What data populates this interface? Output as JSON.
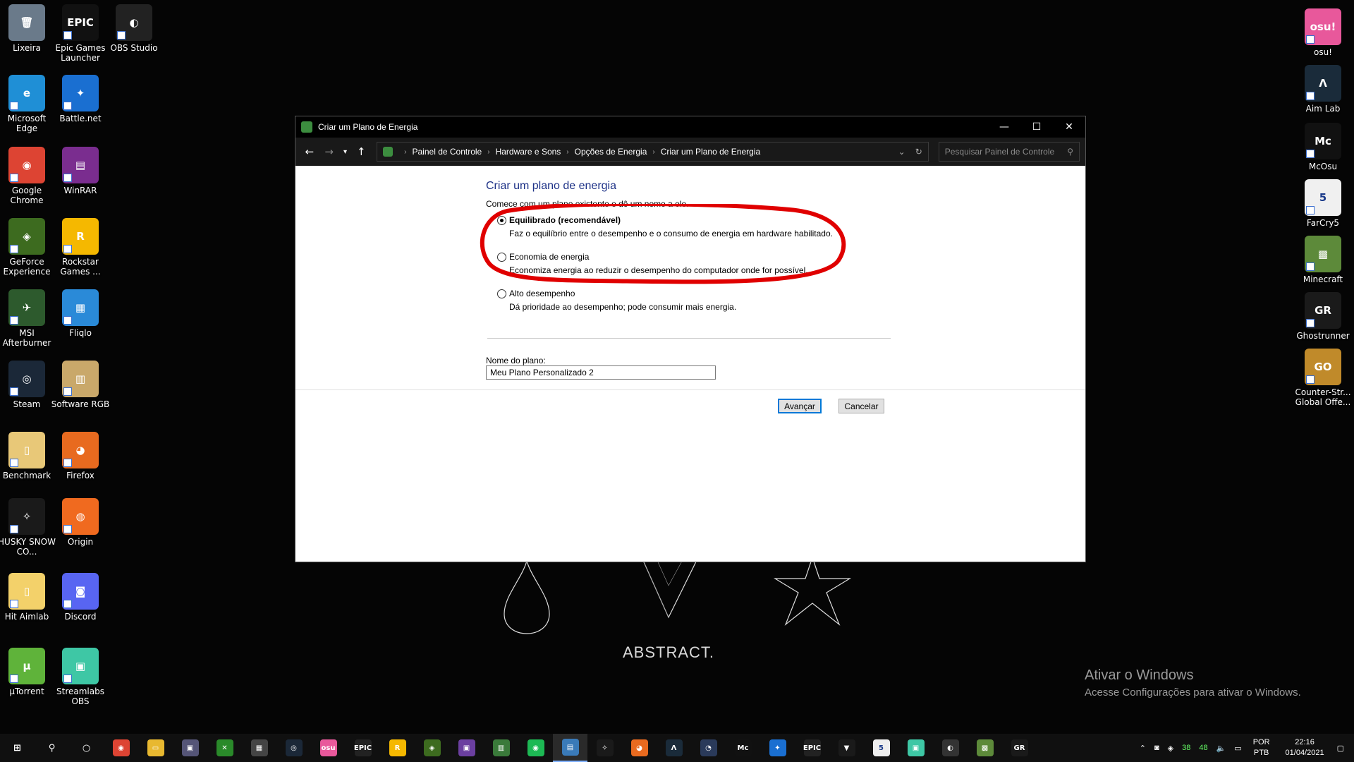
{
  "desktop_left": [
    {
      "label": "Lixeira",
      "color": "#6a7a8a",
      "glyph": "🗑"
    },
    {
      "label": "Epic Games Launcher",
      "color": "#111111",
      "glyph": "EPIC"
    },
    {
      "label": "OBS Studio",
      "color": "#222222",
      "glyph": "◐"
    },
    {
      "label": "Microsoft Edge",
      "color": "#1f8fd6",
      "glyph": "e"
    },
    {
      "label": "Battle.net",
      "color": "#1a6fd1",
      "glyph": "✦"
    },
    {
      "label": "Google Chrome",
      "color": "#dd4433",
      "glyph": "◉"
    },
    {
      "label": "WinRAR",
      "color": "#7a2d8f",
      "glyph": "▤"
    },
    {
      "label": "GeForce Experience",
      "color": "#3d6b1f",
      "glyph": "◈"
    },
    {
      "label": "Rockstar Games ...",
      "color": "#f5b800",
      "glyph": "R"
    },
    {
      "label": "MSI Afterburner",
      "color": "#2d5a2d",
      "glyph": "✈"
    },
    {
      "label": "Fliqlo",
      "color": "#2a8ad8",
      "glyph": "▦"
    },
    {
      "label": "Steam",
      "color": "#1b2838",
      "glyph": "◎"
    },
    {
      "label": "Software RGB",
      "color": "#c9a86a",
      "glyph": "▥"
    },
    {
      "label": "Benchmark",
      "color": "#e8c878",
      "glyph": "▯"
    },
    {
      "label": "Firefox",
      "color": "#e86a1f",
      "glyph": "◕"
    },
    {
      "label": "HUSKY SNOW CO...",
      "color": "#1a1a1a",
      "glyph": "✧"
    },
    {
      "label": "Origin",
      "color": "#f06a1f",
      "glyph": "◍"
    },
    {
      "label": "Hit Aimlab",
      "color": "#f3d16a",
      "glyph": "▯"
    },
    {
      "label": "Discord",
      "color": "#5865f2",
      "glyph": "◙"
    },
    {
      "label": "µTorrent",
      "color": "#5fb33a",
      "glyph": "µ"
    },
    {
      "label": "Streamlabs OBS",
      "color": "#3ec7a5",
      "glyph": "▣"
    }
  ],
  "desktop_right": [
    {
      "label": "osu!",
      "color": "#e8589b",
      "glyph": "osu!"
    },
    {
      "label": "Aim Lab",
      "color": "#1a2b3a",
      "glyph": "Λ"
    },
    {
      "label": "McOsu",
      "color": "#111111",
      "glyph": "Mc"
    },
    {
      "label": "FarCry5",
      "color": "#f0f0f0",
      "glyph": "5"
    },
    {
      "label": "Minecraft",
      "color": "#5d8a3a",
      "glyph": "▩"
    },
    {
      "label": "Ghostrunner",
      "color": "#1a1a1a",
      "glyph": "GR"
    },
    {
      "label": "Counter-Str... Global Offe...",
      "color": "#c08a2a",
      "glyph": "GO"
    }
  ],
  "wallpaper": {
    "text": "ABSTRACT."
  },
  "activation": {
    "title": "Ativar o Windows",
    "subtitle": "Acesse Configurações para ativar o Windows."
  },
  "window": {
    "title": "Criar um Plano de Energia",
    "breadcrumb": [
      "Painel de Controle",
      "Hardware e Sons",
      "Opções de Energia",
      "Criar um Plano de Energia"
    ],
    "search_placeholder": "Pesquisar Painel de Controle",
    "heading": "Criar um plano de energia",
    "intro": "Comece com um plano existente e dê um nome a ele.",
    "options": [
      {
        "label": "Equilibrado (recomendável)",
        "description": "Faz o equilíbrio entre o desempenho e o consumo de energia em hardware habilitado.",
        "selected": true
      },
      {
        "label": "Economia de energia",
        "description": "Economiza energia ao reduzir o desempenho do computador onde for possível.",
        "selected": false
      },
      {
        "label": "Alto desempenho",
        "description": "Dá prioridade ao desempenho; pode consumir mais energia.",
        "selected": false
      }
    ],
    "plan_name_label": "Nome do plano:",
    "plan_name_value": "Meu Plano Personalizado 2",
    "next_button": "Avançar",
    "cancel_button": "Cancelar",
    "annotation_color": "#e00000"
  },
  "taskbar": {
    "apps": [
      {
        "name": "chrome",
        "color": "#dd4433",
        "glyph": "◉"
      },
      {
        "name": "file-explorer",
        "color": "#e8b830",
        "glyph": "▭"
      },
      {
        "name": "photos",
        "color": "#555577",
        "glyph": "▣"
      },
      {
        "name": "xbox",
        "color": "#2a8a2a",
        "glyph": "✕"
      },
      {
        "name": "store",
        "color": "#444444",
        "glyph": "▦"
      },
      {
        "name": "steam",
        "color": "#1b2838",
        "glyph": "◎"
      },
      {
        "name": "osu",
        "color": "#e8589b",
        "glyph": "osu"
      },
      {
        "name": "epic",
        "color": "#222222",
        "glyph": "EPIC"
      },
      {
        "name": "rockstar",
        "color": "#f5b800",
        "glyph": "R"
      },
      {
        "name": "nvidia",
        "color": "#3d6b1f",
        "glyph": "◈"
      },
      {
        "name": "app-purple",
        "color": "#6b3fa0",
        "glyph": "▣"
      },
      {
        "name": "app-green",
        "color": "#3a7a3a",
        "glyph": "▥"
      },
      {
        "name": "spotify",
        "color": "#1db954",
        "glyph": "◉"
      },
      {
        "name": "control-panel",
        "color": "#3a7ab8",
        "glyph": "▤"
      },
      {
        "name": "husky",
        "color": "#1a1a1a",
        "glyph": "✧"
      },
      {
        "name": "firefox",
        "color": "#e86a1f",
        "glyph": "◕"
      },
      {
        "name": "aimlab",
        "color": "#1a2b3a",
        "glyph": "Λ"
      },
      {
        "name": "app-dial",
        "color": "#2a3a5a",
        "glyph": "◔"
      },
      {
        "name": "mcosu",
        "color": "#111111",
        "glyph": "Mc"
      },
      {
        "name": "battlenet",
        "color": "#1a6fd1",
        "glyph": "✦"
      },
      {
        "name": "epic-2",
        "color": "#222222",
        "glyph": "EPIC"
      },
      {
        "name": "razer",
        "color": "#1a1a1a",
        "glyph": "▼"
      },
      {
        "name": "farcry5",
        "color": "#eeeeee",
        "glyph": "5"
      },
      {
        "name": "streamlabs",
        "color": "#3ec7a5",
        "glyph": "▣"
      },
      {
        "name": "obs",
        "color": "#333333",
        "glyph": "◐"
      },
      {
        "name": "minecraft",
        "color": "#5d8a3a",
        "glyph": "▩"
      },
      {
        "name": "ghostrunner",
        "color": "#1a1a1a",
        "glyph": "GR"
      }
    ],
    "tray": {
      "temp1": "38",
      "temp2": "48",
      "lang_line1": "POR",
      "lang_line2": "PTB",
      "time": "22:16",
      "date": "01/04/2021"
    }
  }
}
